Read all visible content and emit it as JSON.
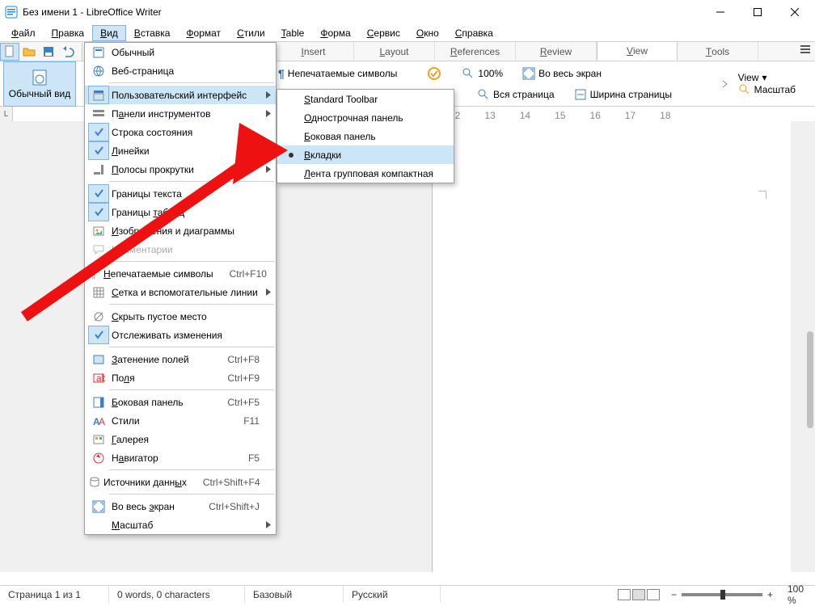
{
  "window": {
    "title": "Без имени 1 - LibreOffice Writer"
  },
  "menubar": [
    "Файл",
    "Правка",
    "Вид",
    "Вставка",
    "Формат",
    "Стили",
    "Table",
    "Форма",
    "Сервис",
    "Окно",
    "Справка"
  ],
  "menubar_open_index": 2,
  "ribbon_tabs": [
    "Insert",
    "Layout",
    "References",
    "Review",
    "View",
    "Tools"
  ],
  "ribbon_active_tab": "View",
  "big_button": "Обычный вид",
  "ribbon_items": {
    "nonprinting": "Непечатаемые символы",
    "zoom100": "100%",
    "fullscreen": "Во весь экран",
    "wholepage": "Вся страница",
    "pagewidth": "Ширина страницы"
  },
  "right_rib": {
    "view": "View",
    "scale": "Масштаб"
  },
  "ruler_marks": [
    "12",
    "13",
    "14",
    "15",
    "16",
    "17",
    "18"
  ],
  "view_menu": [
    {
      "icon": "normal",
      "label": "Обычный"
    },
    {
      "icon": "web",
      "label": "Веб-страница"
    },
    {
      "sep": true
    },
    {
      "icon": "ui",
      "label": "Пользовательский интерфейс",
      "sub": true,
      "hl": true
    },
    {
      "icon": "toolbars",
      "label": "Панели инструментов",
      "sub": true,
      "ul": 1
    },
    {
      "check": true,
      "label": "Строка состояния"
    },
    {
      "check": true,
      "label": "Линейки",
      "sub": true,
      "ul": 0
    },
    {
      "icon": "scroll",
      "label": "Полосы прокрутки",
      "sub": true,
      "ul": 0
    },
    {
      "sep": true
    },
    {
      "check": true,
      "label": "Границы текста"
    },
    {
      "check": true,
      "label": "Границы таблиц",
      "ul": 8
    },
    {
      "icon": "img",
      "label": "Изображения и диаграммы",
      "ul": 0
    },
    {
      "icon": "comment",
      "label": "Комментарии",
      "disabled": true,
      "ul": 0
    },
    {
      "sep": true
    },
    {
      "icon": "pilcrow",
      "label": "Непечатаемые символы",
      "shortcut": "Ctrl+F10",
      "ul": 0
    },
    {
      "icon": "grid",
      "label": "Сетка и вспомогательные линии",
      "sub": true,
      "ul": 0
    },
    {
      "sep": true
    },
    {
      "icon": "hide",
      "label": "Скрыть пустое место",
      "ul": 0
    },
    {
      "check": true,
      "label": "Отслеживать изменения"
    },
    {
      "sep": true
    },
    {
      "icon": "shade",
      "label": "Затенение полей",
      "shortcut": "Ctrl+F8",
      "ul": 0
    },
    {
      "icon": "field",
      "label": "Поля",
      "shortcut": "Ctrl+F9",
      "ul": 2
    },
    {
      "sep": true
    },
    {
      "icon": "side",
      "label": "Боковая панель",
      "shortcut": "Ctrl+F5",
      "ul": 0
    },
    {
      "icon": "styles",
      "label": "Стили",
      "shortcut": "F11"
    },
    {
      "icon": "gallery",
      "label": "Галерея",
      "ul": 0
    },
    {
      "icon": "nav",
      "label": "Навигатор",
      "shortcut": "F5",
      "ul": 1
    },
    {
      "sep": true
    },
    {
      "icon": "data",
      "label": "Источники данных",
      "shortcut": "Ctrl+Shift+F4",
      "ul": 14
    },
    {
      "sep": true
    },
    {
      "icon": "full",
      "label": "Во весь экран",
      "shortcut": "Ctrl+Shift+J",
      "ul": 8
    },
    {
      "label": "Масштаб",
      "sub": true,
      "ul": 0
    }
  ],
  "ui_submenu": [
    {
      "label": "Standard Toolbar",
      "ul": 0
    },
    {
      "label": "Однострочная панель",
      "ul": 0
    },
    {
      "label": "Боковая панель",
      "ul": 0
    },
    {
      "label": "Вкладки",
      "ul": 0,
      "hl": true,
      "bullet": true
    },
    {
      "label": "Лента групповая компактная",
      "ul": 0
    }
  ],
  "status": {
    "page": "Страница 1 из 1",
    "words": "0 words, 0 characters",
    "style": "Базовый",
    "lang": "Русский",
    "zoom": "100 %"
  }
}
